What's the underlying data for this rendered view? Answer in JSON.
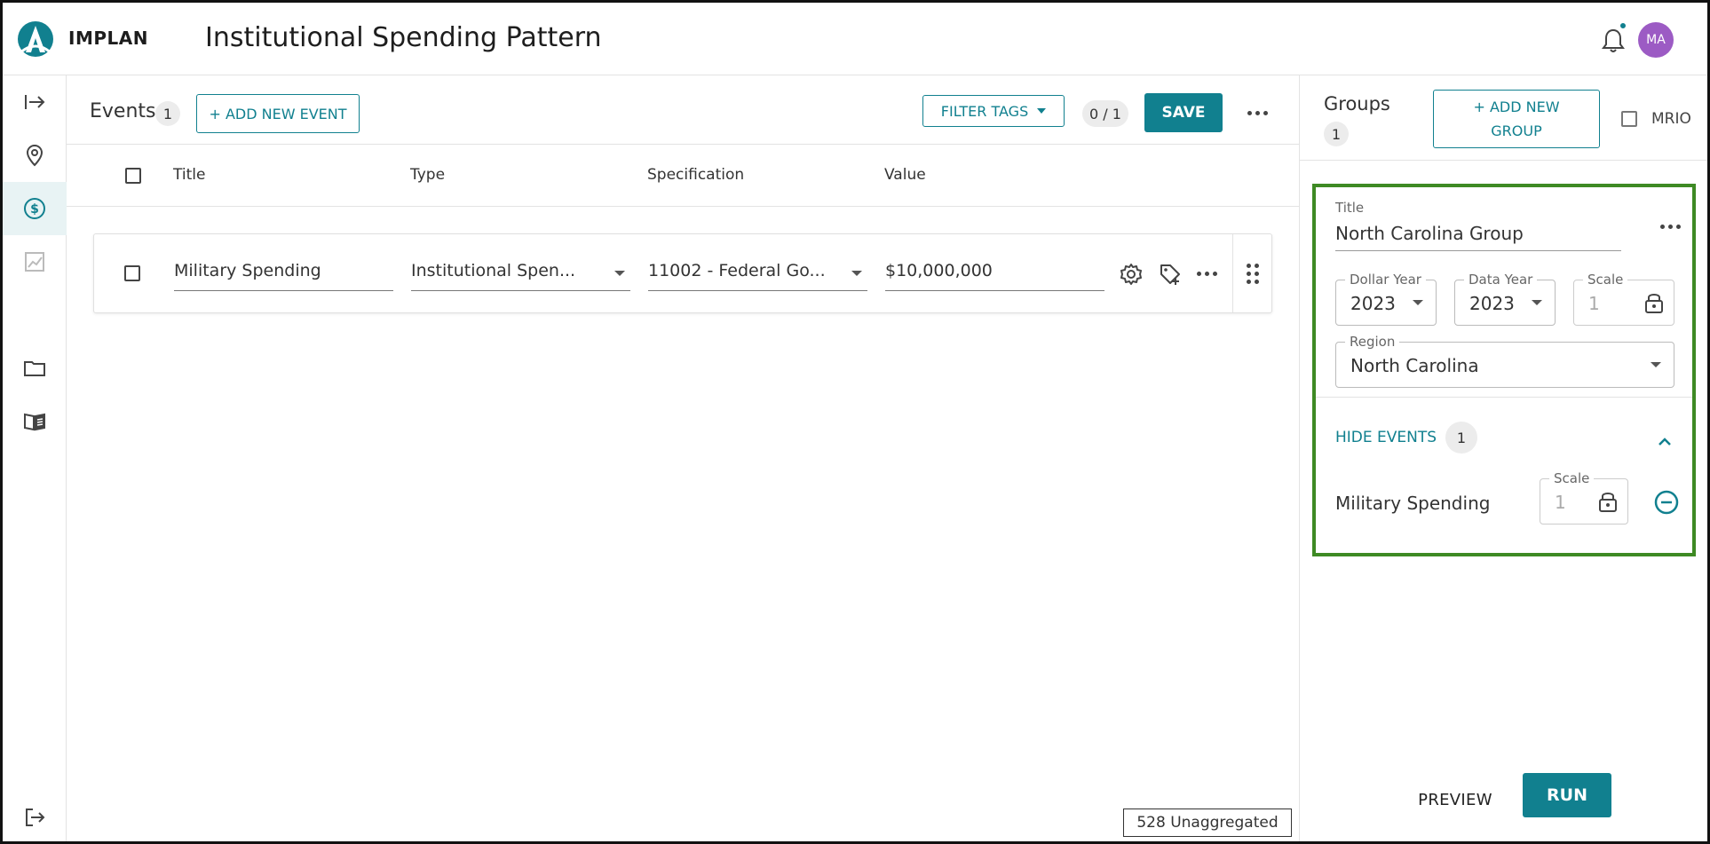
{
  "app": {
    "brand": "IMPLAN",
    "page_title": "Institutional Spending Pattern",
    "avatar_initials": "MA",
    "accent_color": "#11808f",
    "avatar_color": "#9c5bc4"
  },
  "rail": {
    "items": [
      {
        "icon": "expand-arrow-icon"
      },
      {
        "icon": "location-pin-icon"
      },
      {
        "icon": "dollar-icon",
        "active": true
      },
      {
        "icon": "chart-icon",
        "disabled": true
      },
      {
        "icon": "folder-icon"
      },
      {
        "icon": "book-icon"
      },
      {
        "icon": "logout-icon"
      }
    ]
  },
  "events": {
    "label": "Events",
    "count": "1",
    "add_label": "+ ADD NEW EVENT",
    "filter_label": "FILTER TAGS",
    "tag_count": "0 / 1",
    "save_label": "SAVE",
    "columns": {
      "title": "Title",
      "type": "Type",
      "specification": "Specification",
      "value": "Value"
    },
    "rows": [
      {
        "title": "Military Spending",
        "type": "Institutional Spen...",
        "specification": "11002 - Federal Go...",
        "value": "$10,000,000"
      }
    ],
    "unaggregated": "528 Unaggregated"
  },
  "groups": {
    "label": "Groups",
    "count": "1",
    "add_line1": "+ ADD NEW",
    "add_line2": "GROUP",
    "mrio_label": "MRIO",
    "card": {
      "title_caption": "Title",
      "title_value": "North Carolina Group",
      "dollar_year_label": "Dollar Year",
      "dollar_year": "2023",
      "data_year_label": "Data Year",
      "data_year": "2023",
      "scale_label": "Scale",
      "scale": "1",
      "region_label": "Region",
      "region": "North Carolina",
      "hide_events_label": "HIDE EVENTS",
      "hide_events_count": "1",
      "event_name": "Military Spending",
      "event_scale_label": "Scale",
      "event_scale": "1",
      "highlight_color": "#3e8a24"
    }
  },
  "actions": {
    "preview_label": "PREVIEW",
    "run_label": "RUN"
  }
}
